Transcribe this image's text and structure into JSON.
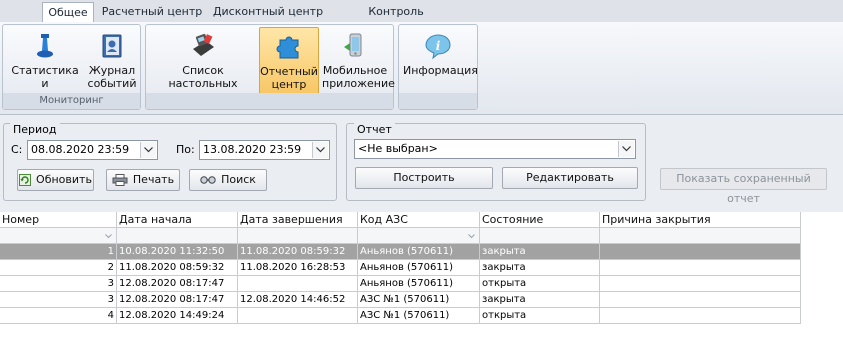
{
  "tabs": [
    {
      "label": "Общее",
      "active": true
    },
    {
      "label": "Расчетный центр",
      "active": false
    },
    {
      "label": "Дисконтный центр",
      "active": false
    },
    {
      "label": "Контроль резервуаров",
      "active": false
    }
  ],
  "ribbon": {
    "groups": [
      {
        "caption": "Мониторинг",
        "buttons": [
          {
            "label": "Статистика и\nуведомления",
            "icon": "bell-icon"
          },
          {
            "label": "Журнал\nсобытий",
            "icon": "journal-icon"
          }
        ]
      },
      {
        "caption": "",
        "buttons": [
          {
            "label": "Список настольных\nтерминалов",
            "icon": "terminal-icon"
          },
          {
            "label": "Отчетный\nцентр",
            "icon": "puzzle-icon",
            "selected": true
          },
          {
            "label": "Мобильное\nприложение",
            "icon": "mobile-icon"
          }
        ]
      },
      {
        "caption": "",
        "buttons": [
          {
            "label": "Информация",
            "icon": "info-icon"
          }
        ]
      }
    ]
  },
  "period": {
    "title": "Период",
    "from_label": "С:",
    "from_value": "08.08.2020 23:59",
    "to_label": "По:",
    "to_value": "13.08.2020 23:59",
    "refresh_label": "Обновить",
    "print_label": "Печать",
    "search_label": "Поиск"
  },
  "report": {
    "title": "Отчет",
    "selected": "<Не выбран>",
    "build_label": "Построить",
    "edit_label": "Редактировать",
    "show_saved_label": "Показать сохраненный отчет"
  },
  "grid": {
    "columns": [
      "Номер",
      "Дата начала",
      "Дата завершения",
      "Код АЗС",
      "Состояние",
      "Причина закрытия"
    ],
    "rows": [
      {
        "num": "1",
        "start": "10.08.2020 11:32:50",
        "end": "11.08.2020 08:59:32",
        "station": "Аньянов (570611)",
        "state": "закрыта",
        "reason": ""
      },
      {
        "num": "2",
        "start": "11.08.2020 08:59:32",
        "end": "11.08.2020 16:28:53",
        "station": "Аньянов (570611)",
        "state": "закрыта",
        "reason": ""
      },
      {
        "num": "3",
        "start": "12.08.2020 08:17:47",
        "end": "",
        "station": "Аньянов (570611)",
        "state": "открыта",
        "reason": ""
      },
      {
        "num": "3",
        "start": "12.08.2020 08:17:47",
        "end": "12.08.2020 14:46:52",
        "station": "АЗС №1 (570611)",
        "state": "закрыта",
        "reason": ""
      },
      {
        "num": "4",
        "start": "12.08.2020 14:49:24",
        "end": "",
        "station": "АЗС №1 (570611)",
        "state": "открыта",
        "reason": ""
      }
    ]
  }
}
